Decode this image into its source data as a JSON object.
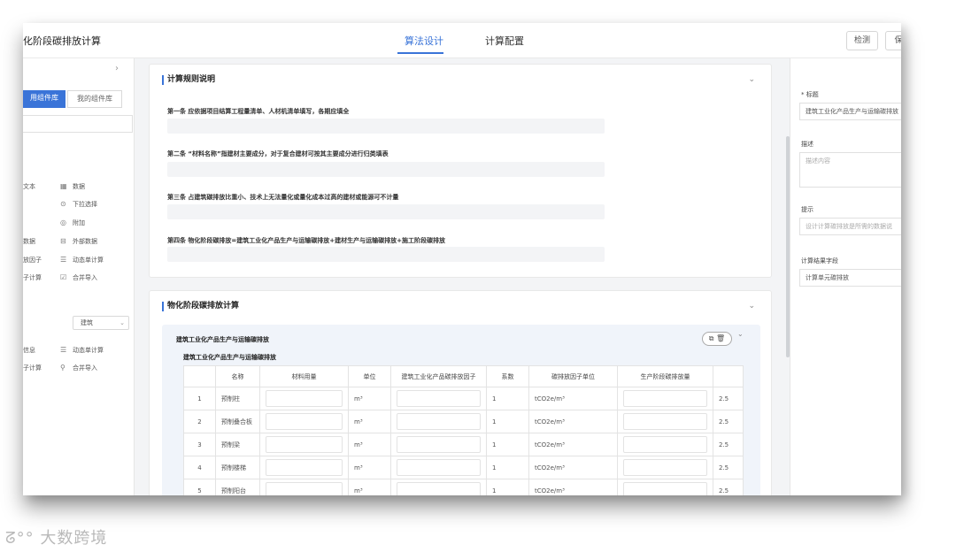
{
  "header": {
    "app_title": "化阶段碳排放计算",
    "tabs": [
      {
        "label": "算法设计",
        "active": true
      },
      {
        "label": "计算配置",
        "active": false
      }
    ],
    "buttons": [
      "检测",
      "保"
    ]
  },
  "left_panel": {
    "tabs": [
      "用组件库",
      "我的组件库"
    ],
    "groups_a": [
      {
        "left": "文本",
        "icon_right": "table-icon",
        "right": "数据"
      },
      {
        "left": "",
        "icon_right": "circle-chevron-icon",
        "right": "下拉选择"
      },
      {
        "left": "",
        "icon_right": "eye-icon",
        "right": "附加"
      },
      {
        "left": "数据",
        "icon_right": "database-icon",
        "right": "外部数据"
      },
      {
        "left": "放因子",
        "icon_right": "list-icon",
        "right": "动态单计算"
      },
      {
        "left": "子计算",
        "icon_right": "import-icon",
        "right": "合并导入"
      }
    ],
    "select_value": "建筑",
    "groups_b": [
      {
        "left": "信息",
        "icon_right": "list-icon",
        "right": "动态单计算"
      },
      {
        "left": "子计算",
        "icon_right": "person-icon",
        "right": "合并导入"
      }
    ]
  },
  "rules_card": {
    "title": "计算规则说明",
    "rules": [
      "第一条 应依据项目结算工程量清单、人材机清单填写，各期应填全",
      "第二条 “材料名称”指建材主要成分，对于复合建材可按其主要成分进行归类填表",
      "第三条 占建筑碳排放比重小、技术上无法量化或量化成本过高的建材或能源可不计量",
      "第四条 物化阶段碳排放=建筑工业化产品生产与运输碳排放+建材生产与运输碳排放+施工阶段碳排放"
    ]
  },
  "calc_card": {
    "title": "物化阶段碳排放计算",
    "inner_title": "建筑工业化产品生产与运输碳排放",
    "sub_title": "建筑工业化产品生产与运输碳排放",
    "icons_text": "⧉ 🗑",
    "columns": [
      "",
      "名称",
      "材料用量",
      "单位",
      "建筑工业化产品碳排放因子",
      "系数",
      "碳排放因子单位",
      "生产阶段碳排放量",
      ""
    ],
    "rows": [
      {
        "idx": "1",
        "name": "预制柱",
        "unit": "m³",
        "coef": "1",
        "factor_unit": "tCO2e/m³",
        "extra": "2.5"
      },
      {
        "idx": "2",
        "name": "预制叠合板",
        "unit": "m³",
        "coef": "1",
        "factor_unit": "tCO2e/m³",
        "extra": "2.5"
      },
      {
        "idx": "3",
        "name": "预制梁",
        "unit": "m³",
        "coef": "1",
        "factor_unit": "tCO2e/m³",
        "extra": "2.5"
      },
      {
        "idx": "4",
        "name": "预制楼梯",
        "unit": "m³",
        "coef": "1",
        "factor_unit": "tCO2e/m³",
        "extra": "2.5"
      },
      {
        "idx": "5",
        "name": "预制阳台",
        "unit": "m³",
        "coef": "1",
        "factor_unit": "tCO2e/m³",
        "extra": "2.5"
      }
    ]
  },
  "right_panel": {
    "title_label": "* 标题",
    "title_value": "建筑工业化产品生产与运输碳排放",
    "desc_label": "描述",
    "desc_placeholder": "描述内容",
    "hint_label": "提示",
    "hint_placeholder": "设计计算碳排放是所需的数据说",
    "result_label": "计算结果字段",
    "result_value": "计算单元碳排放"
  },
  "watermark": "大数跨境",
  "colors": {
    "accent": "#3a74d8",
    "canvas": "#f3f4f6"
  }
}
